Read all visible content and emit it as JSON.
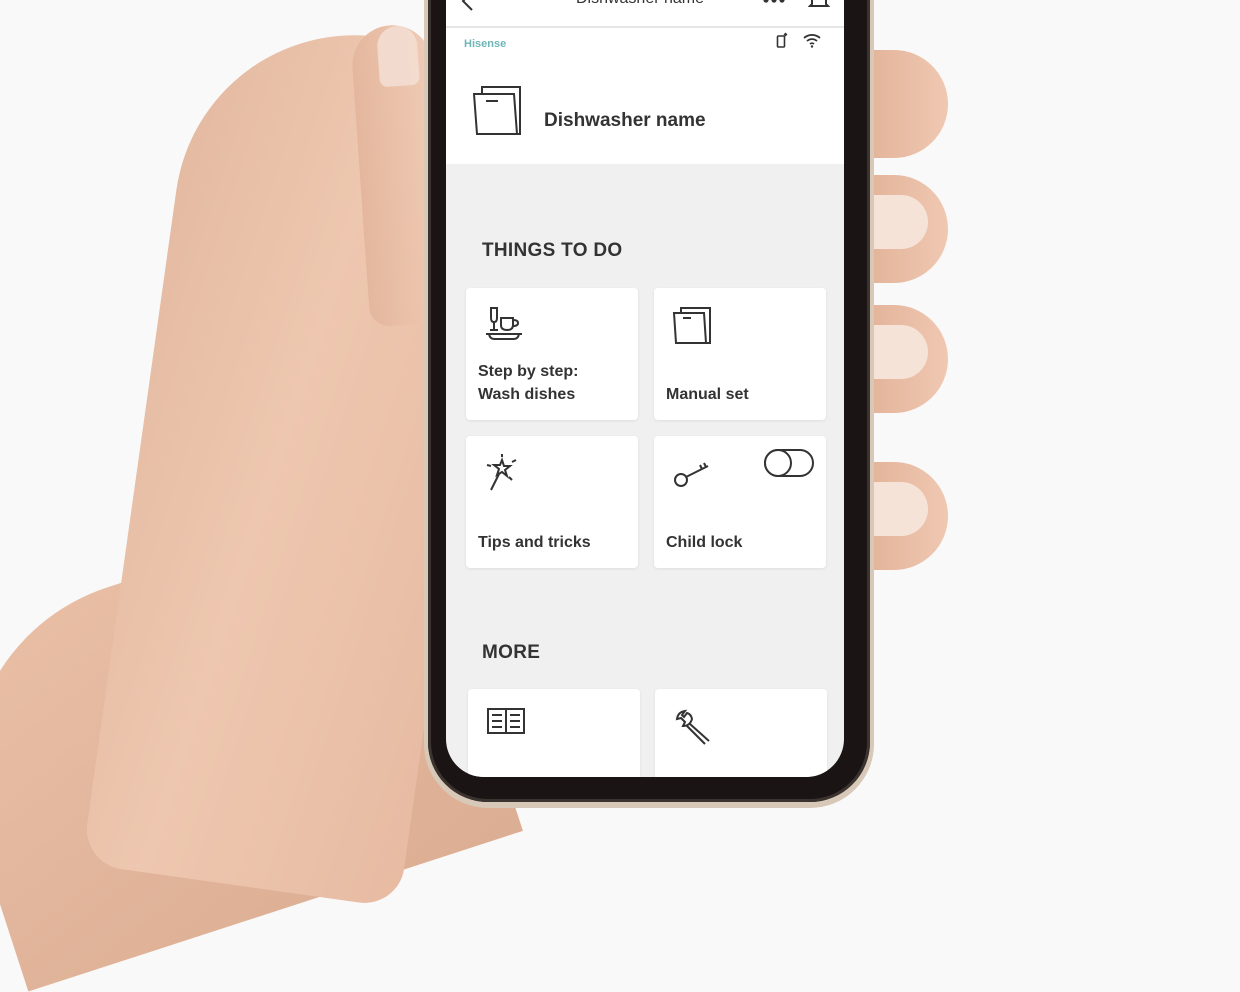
{
  "nav": {
    "title": "Dishwasher name",
    "back_icon": "chevron-left-icon",
    "more_icon": "more-dots-icon",
    "notifications_icon": "bell-icon"
  },
  "header": {
    "brand": "Hisense",
    "status_icons": [
      "remote-control-icon",
      "wifi-icon"
    ],
    "device_icon": "dishwasher-icon",
    "device_name": "Dishwasher name"
  },
  "sections": {
    "things_to_do": {
      "title": "THINGS TO DO",
      "cards": [
        {
          "label": "Step by step:\nWash dishes",
          "icon": "dishes-icon"
        },
        {
          "label": "Manual set",
          "icon": "dishwasher-icon"
        },
        {
          "label": "Tips and tricks",
          "icon": "magic-wand-icon"
        },
        {
          "label": "Child lock",
          "icon": "key-icon",
          "toggle_on": false
        }
      ]
    },
    "more": {
      "title": "MORE",
      "cards": [
        {
          "label": "",
          "icon": "manual-book-icon"
        },
        {
          "label": "",
          "icon": "wrench-icon"
        }
      ]
    }
  }
}
